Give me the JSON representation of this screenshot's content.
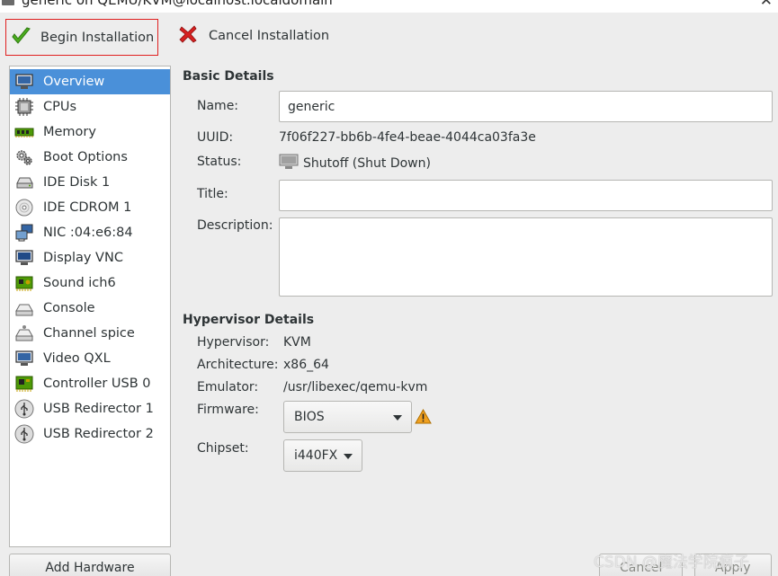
{
  "window": {
    "title": "generic on QEMU/KVM@localhost.localdomain"
  },
  "toolbar": {
    "begin_label": "Begin Installation",
    "cancel_label": "Cancel Installation"
  },
  "sidebar": {
    "items": [
      {
        "label": "Overview",
        "icon": "monitor-icon",
        "selected": true
      },
      {
        "label": "CPUs",
        "icon": "cpu-icon"
      },
      {
        "label": "Memory",
        "icon": "memory-icon"
      },
      {
        "label": "Boot Options",
        "icon": "gears-icon"
      },
      {
        "label": "IDE Disk 1",
        "icon": "disk-icon"
      },
      {
        "label": "IDE CDROM 1",
        "icon": "cdrom-icon"
      },
      {
        "label": "NIC :04:e6:84",
        "icon": "network-icon"
      },
      {
        "label": "Display VNC",
        "icon": "display-icon"
      },
      {
        "label": "Sound ich6",
        "icon": "sound-card-icon"
      },
      {
        "label": "Console",
        "icon": "console-icon"
      },
      {
        "label": "Channel spice",
        "icon": "channel-icon"
      },
      {
        "label": "Video QXL",
        "icon": "video-icon"
      },
      {
        "label": "Controller USB 0",
        "icon": "controller-icon"
      },
      {
        "label": "USB Redirector 1",
        "icon": "usb-icon"
      },
      {
        "label": "USB Redirector 2",
        "icon": "usb-icon"
      }
    ],
    "add_hardware_label": "Add Hardware"
  },
  "basic": {
    "section_title": "Basic Details",
    "name_label": "Name:",
    "name_value": "generic",
    "uuid_label": "UUID:",
    "uuid_value": "7f06f227-bb6b-4fe4-beae-4044ca03fa3e",
    "status_label": "Status:",
    "status_value": "Shutoff (Shut Down)",
    "title_label": "Title:",
    "title_value": "",
    "description_label": "Description:",
    "description_value": ""
  },
  "hypervisor": {
    "section_title": "Hypervisor Details",
    "hypervisor_label": "Hypervisor:",
    "hypervisor_value": "KVM",
    "architecture_label": "Architecture:",
    "architecture_value": "x86_64",
    "emulator_label": "Emulator:",
    "emulator_value": "/usr/libexec/qemu-kvm",
    "firmware_label": "Firmware:",
    "firmware_value": "BIOS",
    "chipset_label": "Chipset:",
    "chipset_value": "i440FX"
  },
  "footer": {
    "cancel_label": "Cancel",
    "apply_label": "Apply"
  },
  "watermark": "CSDN @魔法学院疯子",
  "colors": {
    "selection": "#4a90d9",
    "highlight_border": "#e02020",
    "check_green": "#4caf1e",
    "cancel_red": "#d62020",
    "warning": "#f0a020"
  }
}
